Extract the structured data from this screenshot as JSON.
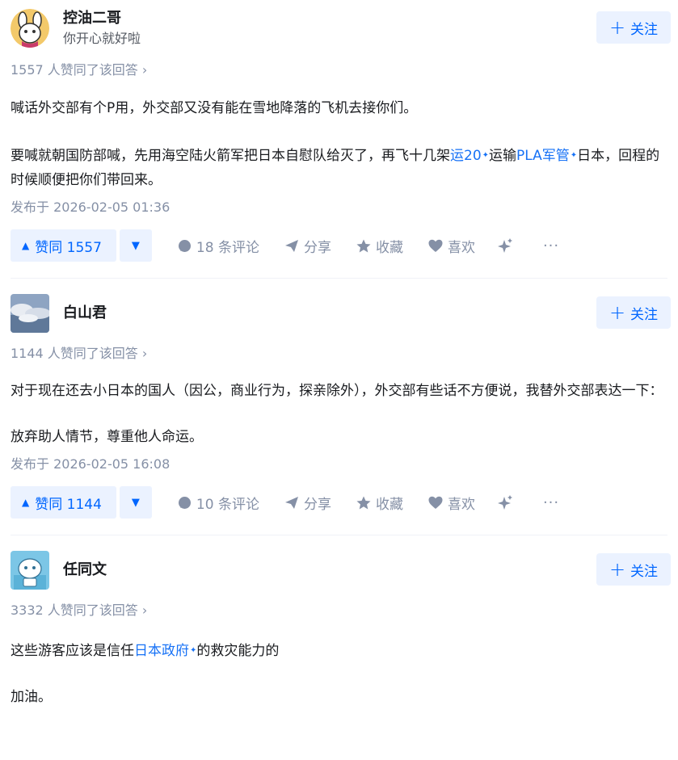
{
  "follow_label": "关注",
  "answers": [
    {
      "author_name": "控油二哥",
      "author_bio": "你开心就好啦",
      "votes_text": "1557 人赞同了该回答 ›",
      "paragraphs": [
        {
          "parts": [
            {
              "t": "喊话外交部有个P用，外交部又没有能在雪地降落的飞机去接你们。"
            }
          ]
        },
        {
          "parts": [
            {
              "t": "要喊就朝国防部喊，先用海空陆火箭军把日本自慰队给灭了，再飞十几架"
            },
            {
              "t": "运20",
              "kw": true
            },
            {
              "t": "运输"
            },
            {
              "t": "PLA军管",
              "kw": true
            },
            {
              "t": "日本，回程的时候顺便把你们带回来。"
            }
          ]
        }
      ],
      "time": "发布于 2026-02-05 01:36",
      "vote_label": "赞同 1557",
      "comments": "18 条评论",
      "share": "分享",
      "collect": "收藏",
      "like": "喜欢",
      "more": "···"
    },
    {
      "author_name": "白山君",
      "author_bio": "",
      "votes_text": "1144 人赞同了该回答 ›",
      "paragraphs": [
        {
          "parts": [
            {
              "t": "对于现在还去小日本的国人（因公，商业行为，探亲除外），外交部有些话不方便说，我替外交部表达一下："
            }
          ]
        },
        {
          "parts": [
            {
              "t": "放弃助人情节，尊重他人命运。"
            }
          ]
        }
      ],
      "time": "发布于 2026-02-05 16:08",
      "vote_label": "赞同 1144",
      "comments": "10 条评论",
      "share": "分享",
      "collect": "收藏",
      "like": "喜欢",
      "more": "···"
    },
    {
      "author_name": "任同文",
      "author_bio": "",
      "votes_text": "3332 人赞同了该回答 ›",
      "paragraphs": [
        {
          "parts": [
            {
              "t": "这些游客应该是信任"
            },
            {
              "t": "日本政府",
              "kw": true
            },
            {
              "t": "的救灾能力的"
            }
          ]
        },
        {
          "parts": [
            {
              "t": "加油。"
            }
          ]
        }
      ]
    }
  ],
  "colors": {
    "accent": "#0066ff",
    "accent_bg": "#ebf2ff",
    "muted": "#8590a6",
    "keyword": "#1772f6"
  }
}
